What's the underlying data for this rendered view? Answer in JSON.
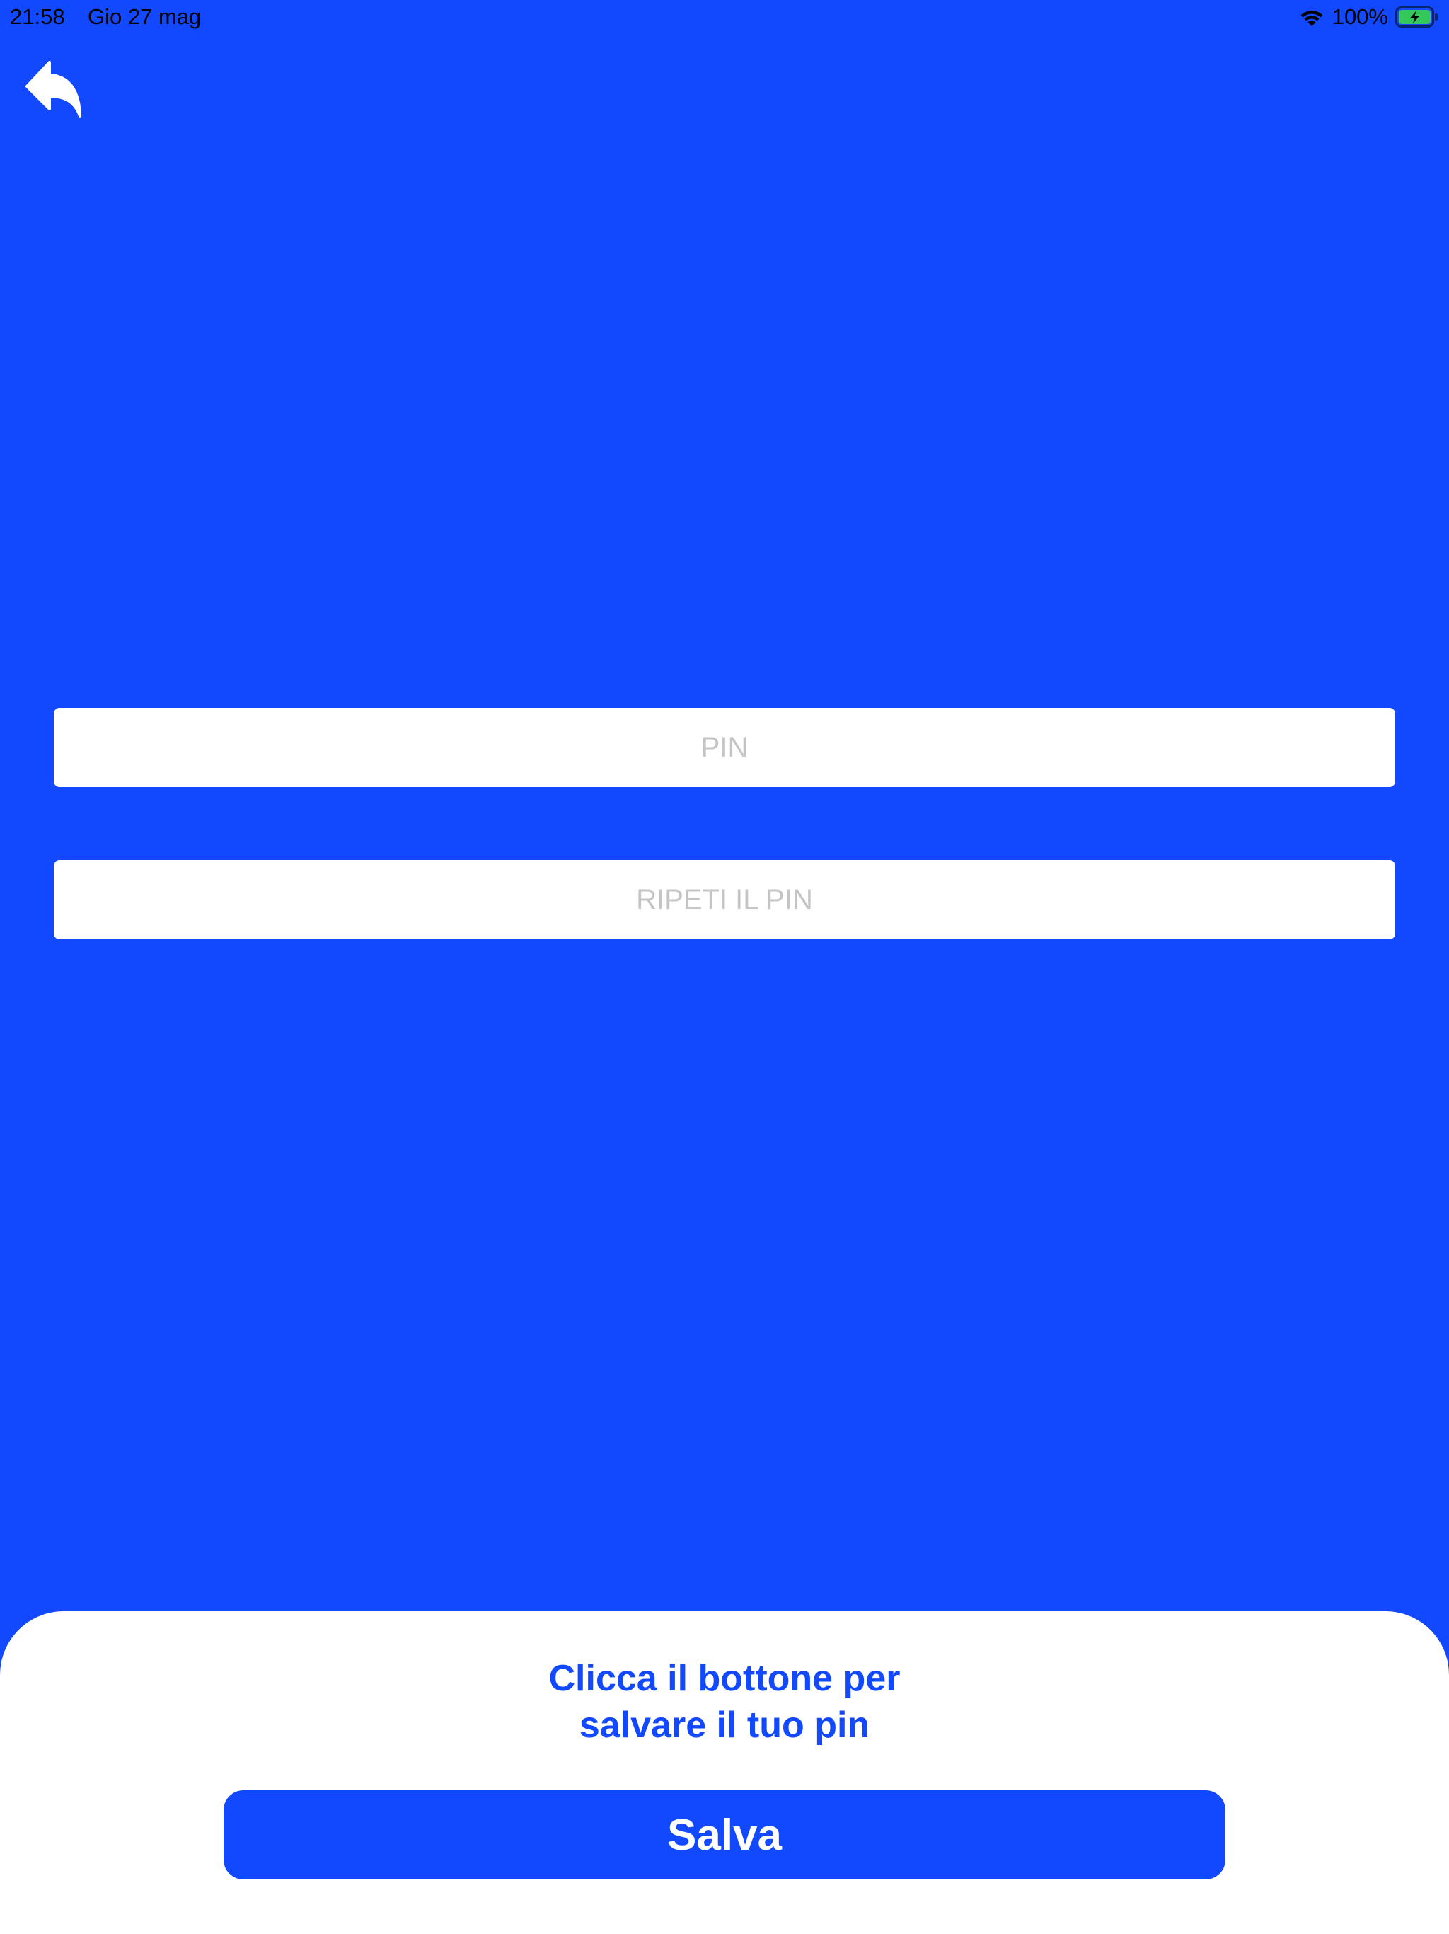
{
  "status_bar": {
    "time": "21:58",
    "date": "Gio 27 mag",
    "battery_percent": "100%",
    "battery_level": 1.0,
    "charging": true,
    "icons": [
      "wifi-icon",
      "battery-charging-icon"
    ]
  },
  "navigation": {
    "back_icon": "back-arrow-icon"
  },
  "form": {
    "pin": {
      "value": "",
      "placeholder": "PIN"
    },
    "pin_repeat": {
      "value": "",
      "placeholder": "RIPETI IL PIN"
    }
  },
  "bottom_sheet": {
    "message_line1": "Clicca il bottone per",
    "message_line2": "salvare il tuo pin",
    "save_label": "Salva"
  },
  "colors": {
    "background": "#1249FF",
    "accent": "#1249FF",
    "sheet": "#FFFFFF",
    "placeholder": "#C4C4C6",
    "battery": "#34C759"
  }
}
